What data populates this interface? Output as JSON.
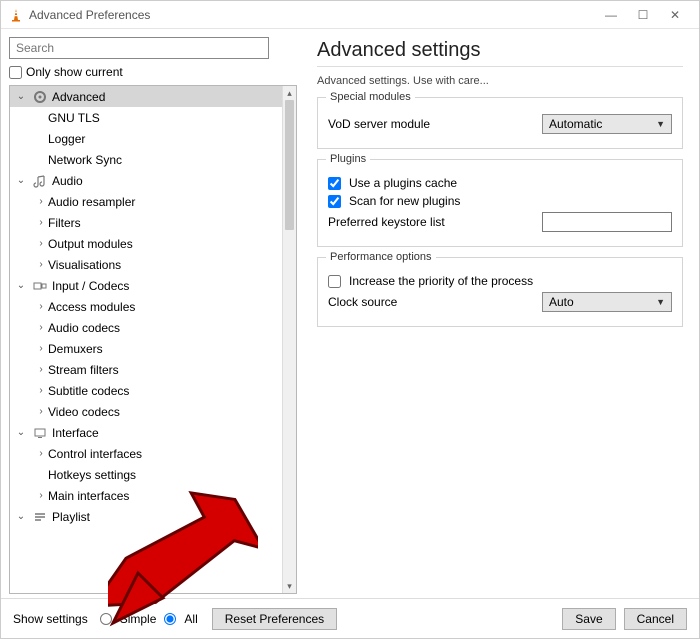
{
  "window": {
    "title": "Advanced Preferences"
  },
  "search": {
    "placeholder": "Search"
  },
  "only_show_current": "Only show current",
  "tree": {
    "advanced": "Advanced",
    "gnu_tls": "GNU TLS",
    "logger": "Logger",
    "network_sync": "Network Sync",
    "audio": "Audio",
    "audio_resampler": "Audio resampler",
    "filters": "Filters",
    "output_modules": "Output modules",
    "visualisations": "Visualisations",
    "input_codecs": "Input / Codecs",
    "access_modules": "Access modules",
    "audio_codecs": "Audio codecs",
    "demuxers": "Demuxers",
    "stream_filters": "Stream filters",
    "subtitle_codecs": "Subtitle codecs",
    "video_codecs": "Video codecs",
    "interface": "Interface",
    "control_interfaces": "Control interfaces",
    "hotkeys_settings": "Hotkeys settings",
    "main_interfaces": "Main interfaces",
    "playlist": "Playlist"
  },
  "main": {
    "title": "Advanced settings",
    "subtitle": "Advanced settings. Use with care...",
    "special_modules": {
      "title": "Special modules",
      "vod_label": "VoD server module",
      "vod_value": "Automatic"
    },
    "plugins": {
      "title": "Plugins",
      "use_cache": "Use a plugins cache",
      "scan_new": "Scan for new plugins",
      "keystore_label": "Preferred keystore list"
    },
    "performance": {
      "title": "Performance options",
      "increase_prio": "Increase the priority of the process",
      "clock_label": "Clock source",
      "clock_value": "Auto"
    }
  },
  "footer": {
    "show_settings": "Show settings",
    "simple": "Simple",
    "all": "All",
    "reset": "Reset Preferences",
    "save": "Save",
    "cancel": "Cancel"
  }
}
